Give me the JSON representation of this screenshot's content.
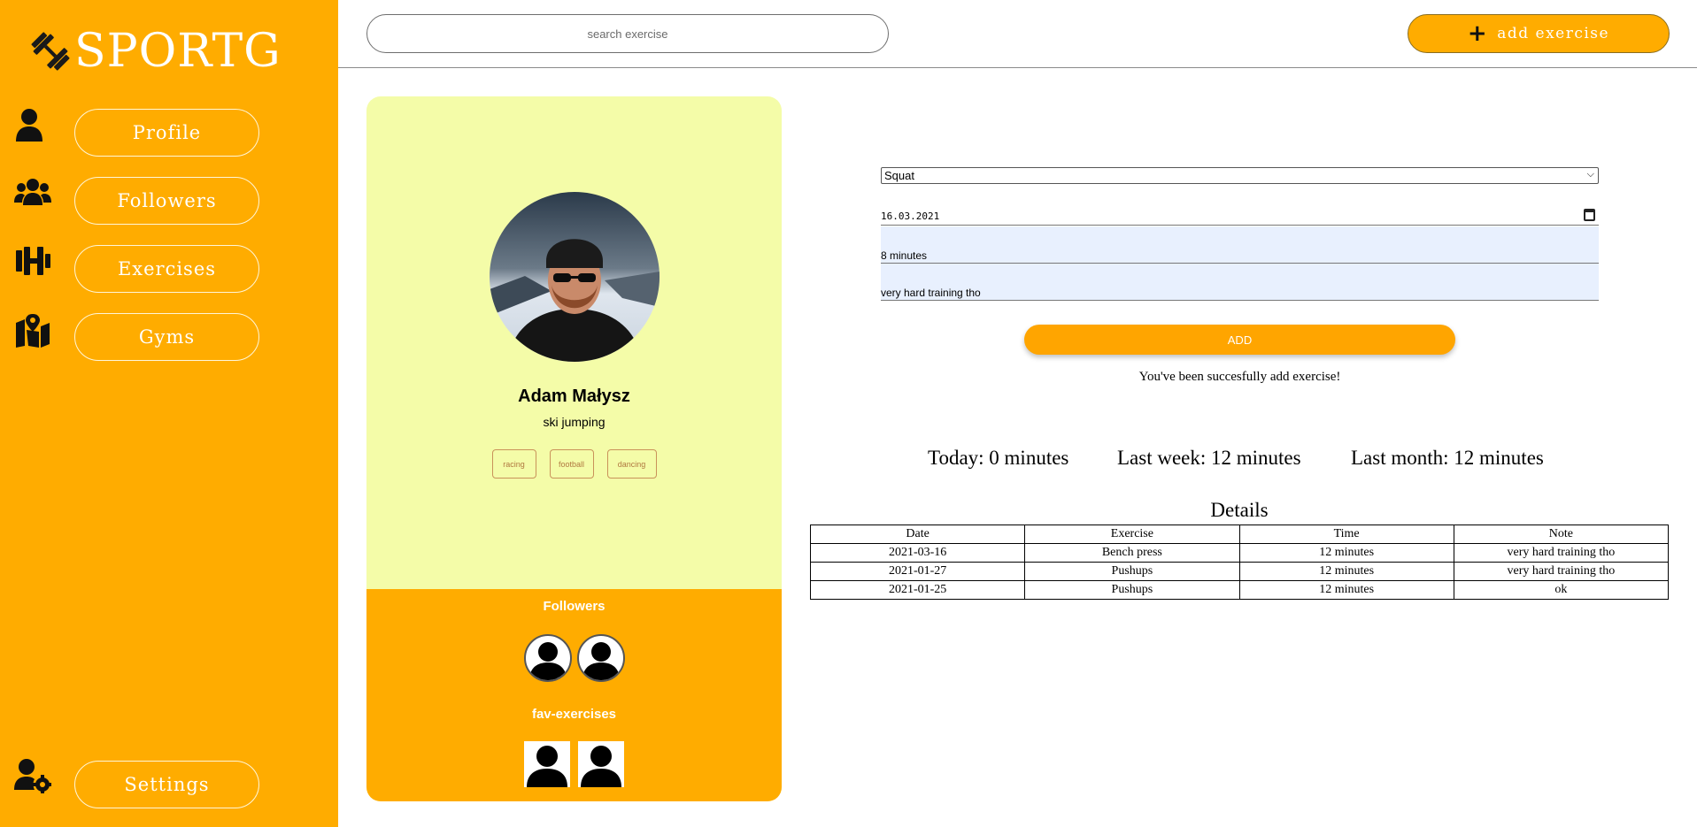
{
  "app": {
    "logo_text": "SPORTG",
    "logo_icon": "dumbbell-icon"
  },
  "sidebar": {
    "items": [
      {
        "label": "Profile",
        "icon": "user-icon"
      },
      {
        "label": "Followers",
        "icon": "users-icon"
      },
      {
        "label": "Exercises",
        "icon": "dumbbell-icon"
      },
      {
        "label": "Gyms",
        "icon": "map-marker-icon"
      }
    ],
    "settings": {
      "label": "Settings",
      "icon": "user-gear-icon"
    }
  },
  "header": {
    "search_placeholder": "search exercise",
    "add_label": "add exercise",
    "add_icon": "plus-icon"
  },
  "profile": {
    "name": "Adam Małysz",
    "sport": "ski jumping",
    "tags": [
      "racing",
      "football",
      "dancing"
    ],
    "followers_title": "Followers",
    "fav_title": "fav-exercises"
  },
  "form": {
    "exercise": "Squat",
    "date": "16.03.2021",
    "time": "8 minutes",
    "note": "very hard training tho",
    "add_label": "ADD",
    "success": "You've been succesfully add exercise!"
  },
  "stats": {
    "today": "Today: 0 minutes",
    "week": "Last week: 12 minutes",
    "month": "Last month: 12 minutes"
  },
  "details": {
    "title": "Details",
    "columns": [
      "Date",
      "Exercise",
      "Time",
      "Note"
    ],
    "rows": [
      [
        "2021-03-16",
        "Bench press",
        "12 minutes",
        "very hard training tho"
      ],
      [
        "2021-01-27",
        "Pushups",
        "12 minutes",
        "very hard training tho"
      ],
      [
        "2021-01-25",
        "Pushups",
        "12 minutes",
        "ok"
      ]
    ]
  },
  "colors": {
    "accent": "#ffac00",
    "card": "#f4fca8",
    "autofill": "#e8f0fe"
  }
}
